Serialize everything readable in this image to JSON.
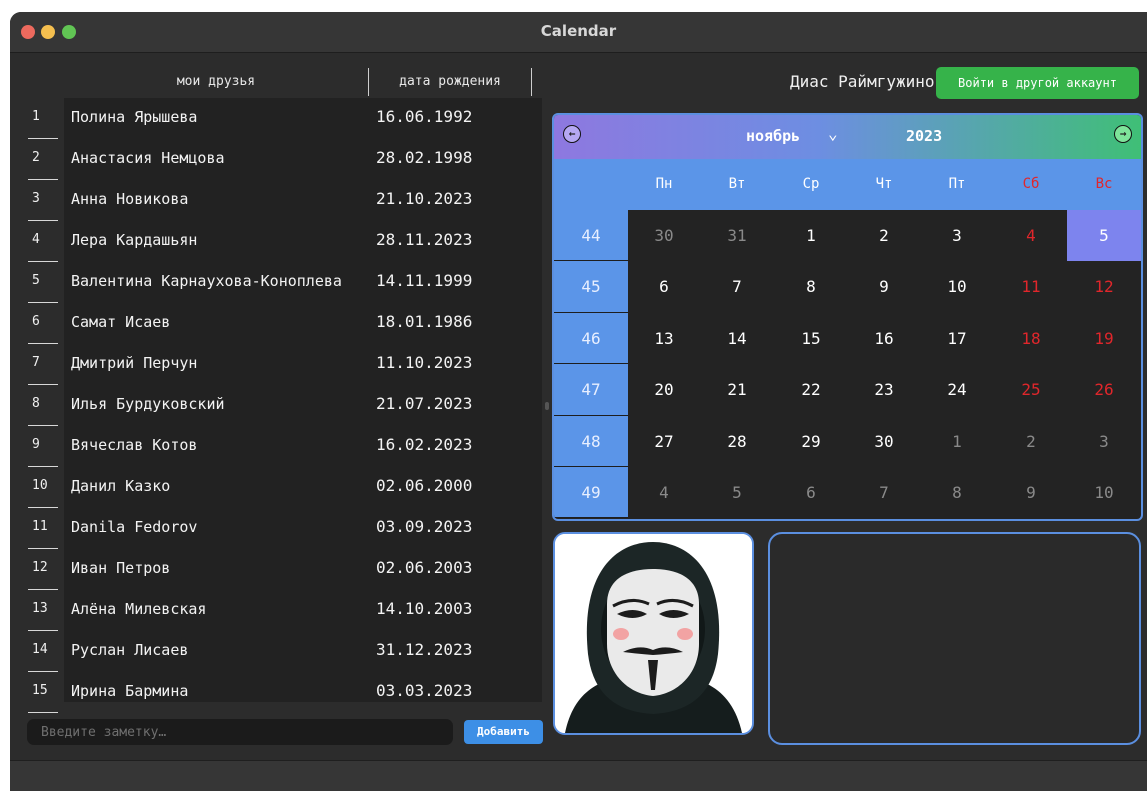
{
  "window": {
    "title": "Calendar"
  },
  "friends": {
    "col_name": "мои друзья",
    "col_date": "дата рождения",
    "rows": [
      {
        "n": "1",
        "name": "Полина Ярышева",
        "date": "16.06.1992"
      },
      {
        "n": "2",
        "name": "Анастасия Немцова",
        "date": "28.02.1998"
      },
      {
        "n": "3",
        "name": "Анна Новикова",
        "date": "21.10.2023"
      },
      {
        "n": "4",
        "name": "Лера Кардашьян",
        "date": "28.11.2023"
      },
      {
        "n": "5",
        "name": "Валентина Карнаухова-Коноплева",
        "date": "14.11.1999"
      },
      {
        "n": "6",
        "name": "Самат Исаев",
        "date": "18.01.1986"
      },
      {
        "n": "7",
        "name": "Дмитрий Перчун",
        "date": "11.10.2023"
      },
      {
        "n": "8",
        "name": "Илья Бурдуковский",
        "date": "21.07.2023"
      },
      {
        "n": "9",
        "name": "Вячеслав Котов",
        "date": "16.02.2023"
      },
      {
        "n": "10",
        "name": "Данил Казко",
        "date": "02.06.2000"
      },
      {
        "n": "11",
        "name": "Danila Fedorov",
        "date": "03.09.2023"
      },
      {
        "n": "12",
        "name": "Иван Петров",
        "date": "02.06.2003"
      },
      {
        "n": "13",
        "name": "Алёна Милевская",
        "date": "14.10.2003"
      },
      {
        "n": "14",
        "name": "Руслан Лисаев",
        "date": "31.12.2023"
      },
      {
        "n": "15",
        "name": "Ирина Бармина",
        "date": "03.03.2023"
      }
    ]
  },
  "note": {
    "placeholder": "Введите заметку…",
    "add_label": "Добавить"
  },
  "account": {
    "user_name": "Диас Раймгужинов",
    "switch_label": "Войти в другой аккаунт"
  },
  "calendar": {
    "month": "ноябрь",
    "year": "2023",
    "weekdays": [
      "Пн",
      "Вт",
      "Ср",
      "Чт",
      "Пт",
      "Сб",
      "Вс"
    ],
    "weeks": [
      {
        "num": "44",
        "days": [
          {
            "d": "30",
            "kind": "other"
          },
          {
            "d": "31",
            "kind": "other"
          },
          {
            "d": "1",
            "kind": "cur"
          },
          {
            "d": "2",
            "kind": "cur"
          },
          {
            "d": "3",
            "kind": "cur"
          },
          {
            "d": "4",
            "kind": "weekend"
          },
          {
            "d": "5",
            "kind": "today"
          }
        ]
      },
      {
        "num": "45",
        "days": [
          {
            "d": "6",
            "kind": "cur"
          },
          {
            "d": "7",
            "kind": "cur"
          },
          {
            "d": "8",
            "kind": "cur"
          },
          {
            "d": "9",
            "kind": "cur"
          },
          {
            "d": "10",
            "kind": "cur"
          },
          {
            "d": "11",
            "kind": "weekend"
          },
          {
            "d": "12",
            "kind": "weekend"
          }
        ]
      },
      {
        "num": "46",
        "days": [
          {
            "d": "13",
            "kind": "cur"
          },
          {
            "d": "14",
            "kind": "cur"
          },
          {
            "d": "15",
            "kind": "cur"
          },
          {
            "d": "16",
            "kind": "cur"
          },
          {
            "d": "17",
            "kind": "cur"
          },
          {
            "d": "18",
            "kind": "weekend"
          },
          {
            "d": "19",
            "kind": "weekend"
          }
        ]
      },
      {
        "num": "47",
        "days": [
          {
            "d": "20",
            "kind": "cur"
          },
          {
            "d": "21",
            "kind": "cur"
          },
          {
            "d": "22",
            "kind": "cur"
          },
          {
            "d": "23",
            "kind": "cur"
          },
          {
            "d": "24",
            "kind": "cur"
          },
          {
            "d": "25",
            "kind": "weekend"
          },
          {
            "d": "26",
            "kind": "weekend"
          }
        ]
      },
      {
        "num": "48",
        "days": [
          {
            "d": "27",
            "kind": "cur"
          },
          {
            "d": "28",
            "kind": "cur"
          },
          {
            "d": "29",
            "kind": "cur"
          },
          {
            "d": "30",
            "kind": "cur"
          },
          {
            "d": "1",
            "kind": "other"
          },
          {
            "d": "2",
            "kind": "other"
          },
          {
            "d": "3",
            "kind": "other"
          }
        ]
      },
      {
        "num": "49",
        "days": [
          {
            "d": "4",
            "kind": "other"
          },
          {
            "d": "5",
            "kind": "other"
          },
          {
            "d": "6",
            "kind": "other"
          },
          {
            "d": "7",
            "kind": "other"
          },
          {
            "d": "8",
            "kind": "other"
          },
          {
            "d": "9",
            "kind": "other"
          },
          {
            "d": "10",
            "kind": "other"
          }
        ]
      }
    ]
  },
  "colors": {
    "accent": "#5b95e8",
    "weekend": "#e0262b",
    "today": "#7d84ee",
    "other_month": "#8a8a8a",
    "current_month": "#ffffff",
    "green_button": "#36b34a"
  },
  "icons": {
    "prev": "arrow-left-circle-icon",
    "next": "arrow-right-circle-icon",
    "month_dropdown": "chevron-down-icon"
  }
}
